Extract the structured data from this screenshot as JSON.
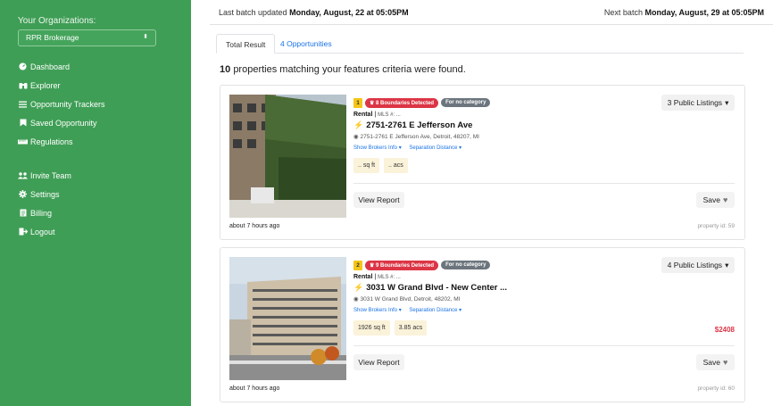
{
  "sidebar": {
    "org_label": "Your Organizations:",
    "org_selected": "RPR Brokerage",
    "nav": [
      {
        "label": "Dashboard",
        "icon": "dashboard-icon"
      },
      {
        "label": "Explorer",
        "icon": "binoculars-icon"
      },
      {
        "label": "Opportunity Trackers",
        "icon": "list-icon"
      },
      {
        "label": "Saved Opportunity",
        "icon": "bookmark-icon"
      },
      {
        "label": "Regulations",
        "icon": "ruler-icon"
      }
    ],
    "nav2": [
      {
        "label": "Invite Team",
        "icon": "users-icon"
      },
      {
        "label": "Settings",
        "icon": "gear-icon"
      },
      {
        "label": "Billing",
        "icon": "billing-icon"
      },
      {
        "label": "Logout",
        "icon": "logout-icon"
      }
    ]
  },
  "topbar": {
    "last_prefix": "Last batch updated",
    "last_value": "Monday, August, 22 at 05:05PM",
    "next_prefix": "Next batch",
    "next_value": "Monday, August, 29 at 05:05PM"
  },
  "tabs": {
    "total": "Total Result",
    "opportunities": "4 Opportunities"
  },
  "results": {
    "count": "10",
    "text": "properties matching your features criteria were found."
  },
  "cards": [
    {
      "rank": "1",
      "boundaries": "8 Boundaries Detected",
      "category": "For no category",
      "type": "Rental",
      "mls": "MLS #: ...",
      "title": "2751-2761 E Jefferson Ave",
      "address": "2751-2761 E Jefferson Ave, Detroit, 48207, MI",
      "brokers_link": "Show Brokers Info ▾",
      "separation_link": "Separation Distance ▾",
      "sqft": ".. sq ft",
      "acres": ".. acs",
      "price": "",
      "listings": "3 Public Listings",
      "view": "View Report",
      "save": "Save",
      "ago": "about 7 hours ago",
      "property_id": "property id: 59"
    },
    {
      "rank": "2",
      "boundaries": "9 Boundaries Detected",
      "category": "For no category",
      "type": "Rental",
      "mls": "MLS #: ...",
      "title": "3031 W Grand Blvd - New Center ...",
      "address": "3031 W Grand Blvd, Detroit, 48202, MI",
      "brokers_link": "Show Brokers Info ▾",
      "separation_link": "Separation Distance ▾",
      "sqft": "1926 sq ft",
      "acres": "3.85 acs",
      "price": "$2408",
      "listings": "4 Public Listings",
      "view": "View Report",
      "save": "Save",
      "ago": "about 7 hours ago",
      "property_id": "property id: 60"
    }
  ]
}
